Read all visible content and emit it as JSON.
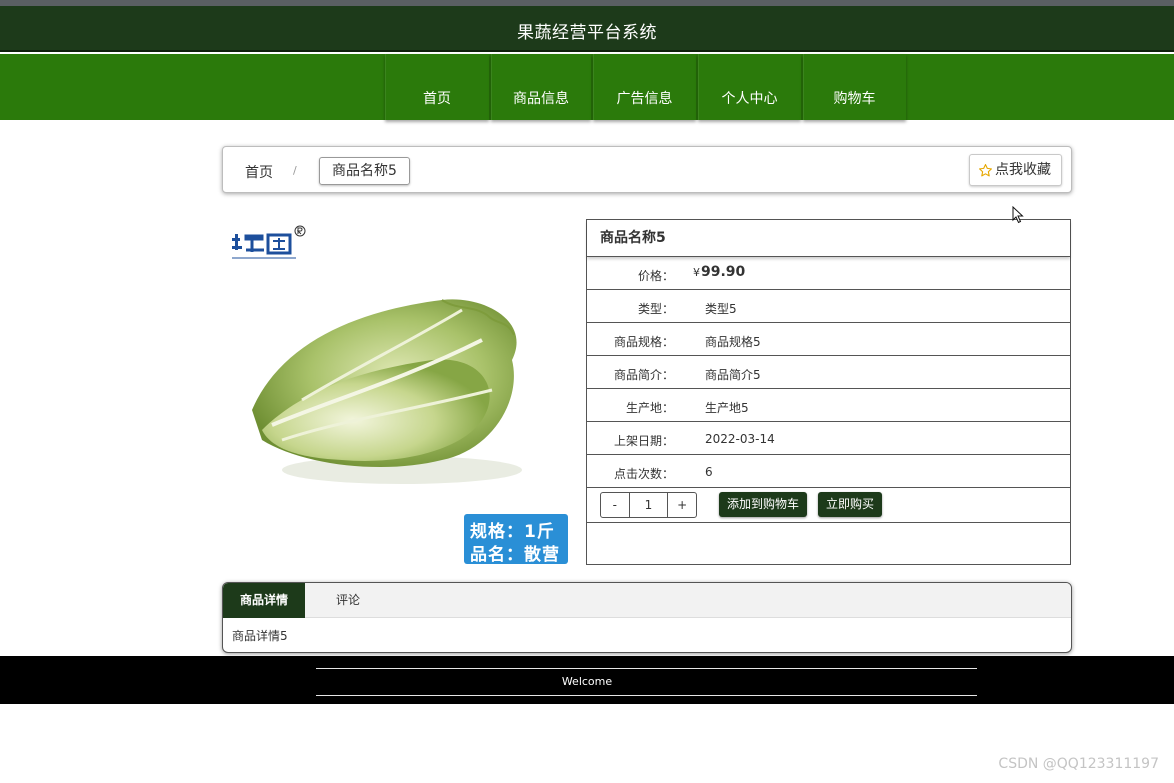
{
  "app": {
    "title": "果蔬经营平台系统"
  },
  "nav": {
    "items": [
      "首页",
      "商品信息",
      "广告信息",
      "个人中心",
      "购物车"
    ]
  },
  "breadcrumb": {
    "home": "首页",
    "separator": "/",
    "current": "商品名称5"
  },
  "favorite": {
    "label": "点我收藏",
    "icon": "star-icon"
  },
  "image": {
    "badge_line1": "规格：1斤",
    "badge_line2": "品名：散营"
  },
  "product": {
    "name": "商品名称5",
    "price_label": "价格：",
    "price_currency": "¥",
    "price": "99.90",
    "fields": [
      {
        "label": "类型：",
        "value": "类型5"
      },
      {
        "label": "商品规格：",
        "value": "商品规格5"
      },
      {
        "label": "商品简介：",
        "value": "商品简介5"
      },
      {
        "label": "生产地：",
        "value": "生产地5"
      },
      {
        "label": "上架日期：",
        "value": "2022-03-14"
      },
      {
        "label": "点击次数：",
        "value": "6"
      }
    ],
    "quantity": "1",
    "minus": "-",
    "plus": "+",
    "add_to_cart": "添加到购物车",
    "buy_now": "立即购买"
  },
  "tabs": {
    "items": [
      "商品详情",
      "评论"
    ],
    "active": "商品详情",
    "content": "商品详情5"
  },
  "footer": {
    "welcome": "Welcome"
  },
  "watermark": "CSDN @QQ123311197",
  "colors": {
    "header": "#1d3a1a",
    "nav": "#2b7a0b",
    "button": "#1d3a1a",
    "footer": "#000000"
  }
}
